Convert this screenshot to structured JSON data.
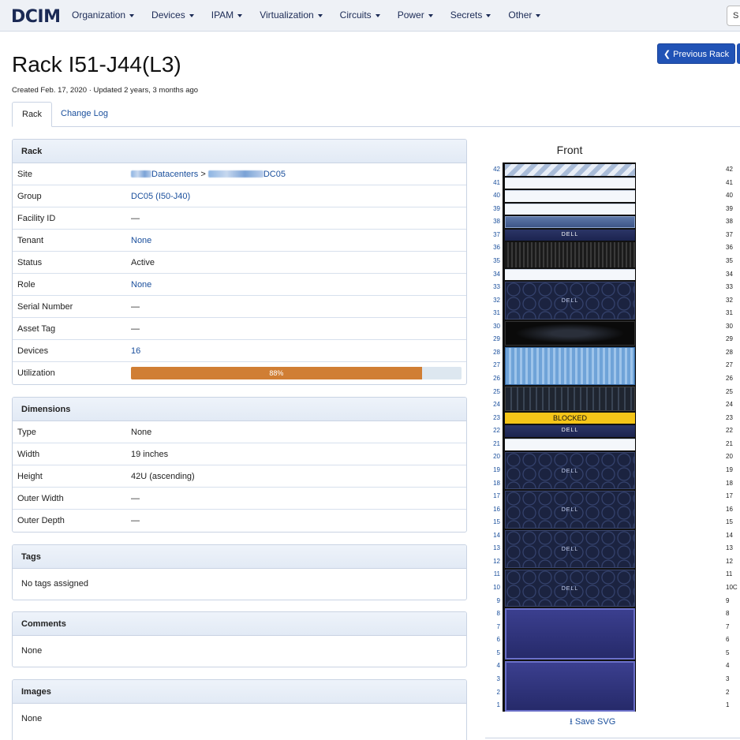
{
  "nav": {
    "brand": "DCIM",
    "items": [
      "Organization",
      "Devices",
      "IPAM",
      "Virtualization",
      "Circuits",
      "Power",
      "Secrets",
      "Other"
    ],
    "search_text": "S"
  },
  "header": {
    "title": "Rack I51-J44(L3)",
    "meta": "Created Feb. 17, 2020 · Updated 2 years, 3 months ago",
    "prev_rack": "Previous Rack"
  },
  "tabs": [
    "Rack",
    "Change Log"
  ],
  "rack_panel": {
    "heading": "Rack",
    "rows": [
      {
        "label": "Site",
        "value": ""
      },
      {
        "label": "Group",
        "value": "DC05 (I50-J40)"
      },
      {
        "label": "Facility ID",
        "value": "—"
      },
      {
        "label": "Tenant",
        "value": "None"
      },
      {
        "label": "Status",
        "value": "Active"
      },
      {
        "label": "Role",
        "value": "None"
      },
      {
        "label": "Serial Number",
        "value": "—"
      },
      {
        "label": "Asset Tag",
        "value": "—"
      },
      {
        "label": "Devices",
        "value": "16"
      },
      {
        "label": "Utilization",
        "value": "88%"
      }
    ],
    "site_parts": {
      "a": "Datacenters",
      "sep": " > ",
      "b": "DC05"
    },
    "utilization_fraction": 0.88
  },
  "dimensions_panel": {
    "heading": "Dimensions",
    "rows": [
      {
        "label": "Type",
        "value": "None"
      },
      {
        "label": "Width",
        "value": "19 inches"
      },
      {
        "label": "Height",
        "value": "42U (ascending)"
      },
      {
        "label": "Outer Width",
        "value": "—"
      },
      {
        "label": "Outer Depth",
        "value": "—"
      }
    ]
  },
  "tags_panel": {
    "heading": "Tags",
    "body": "No tags assigned"
  },
  "comments_panel": {
    "heading": "Comments",
    "body": "None"
  },
  "images_panel": {
    "heading": "Images",
    "body": "None"
  },
  "rack": {
    "title": "Front",
    "units": 42,
    "blocked_label": "BLOCKED",
    "device_label": "DELL",
    "save_svg": "Save SVG",
    "right_partial_digit": "C",
    "occupants": [
      {
        "kind": "reserved",
        "top_u": 42,
        "height": 1
      },
      {
        "kind": "empty",
        "top_u": 41,
        "height": 1
      },
      {
        "kind": "empty",
        "top_u": 40,
        "height": 1
      },
      {
        "kind": "empty",
        "top_u": 39,
        "height": 1
      },
      {
        "kind": "blue1u",
        "top_u": 38,
        "height": 1
      },
      {
        "kind": "dell1u",
        "top_u": 37,
        "height": 1
      },
      {
        "kind": "dense2u",
        "top_u": 36,
        "height": 2
      },
      {
        "kind": "empty",
        "top_u": 34,
        "height": 1
      },
      {
        "kind": "hex3u",
        "top_u": 33,
        "height": 3
      },
      {
        "kind": "black2u",
        "top_u": 30,
        "height": 2
      },
      {
        "kind": "lightblue3u",
        "top_u": 28,
        "height": 3
      },
      {
        "kind": "dark2u",
        "top_u": 25,
        "height": 2
      },
      {
        "kind": "blocked",
        "top_u": 23,
        "height": 1
      },
      {
        "kind": "dell1u",
        "top_u": 22,
        "height": 1
      },
      {
        "kind": "empty",
        "top_u": 21,
        "height": 1
      },
      {
        "kind": "hex3u",
        "top_u": 20,
        "height": 3
      },
      {
        "kind": "hex3u",
        "top_u": 17,
        "height": 3
      },
      {
        "kind": "hex3u",
        "top_u": 14,
        "height": 3
      },
      {
        "kind": "hex3u",
        "top_u": 11,
        "height": 3
      },
      {
        "kind": "purple4u",
        "top_u": 8,
        "height": 4
      },
      {
        "kind": "purple4u",
        "top_u": 4,
        "height": 4
      }
    ]
  },
  "colors": {
    "nav_bg": "#eef1f6",
    "primary": "#2153b6",
    "link": "#1a4f9c",
    "progress": "#d07e34",
    "blocked": "#f5c518"
  }
}
